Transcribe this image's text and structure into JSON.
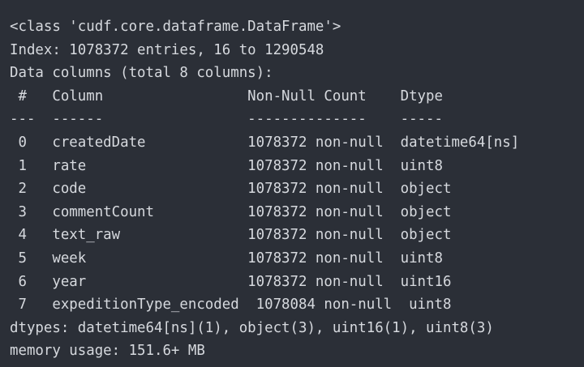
{
  "output": {
    "class_line": "<class 'cudf.core.dataframe.DataFrame'>",
    "index_line": "Index: 1078372 entries, 16 to 1290548",
    "columns_summary": "Data columns (total 8 columns):",
    "header_line": " #   Column                 Non-Null Count    Dtype",
    "separator_line": "---  ------                 --------------    -----",
    "rows": [
      " 0   createdDate            1078372 non-null  datetime64[ns]",
      " 1   rate                   1078372 non-null  uint8",
      " 2   code                   1078372 non-null  object",
      " 3   commentCount           1078372 non-null  object",
      " 4   text_raw               1078372 non-null  object",
      " 5   week                   1078372 non-null  uint8",
      " 6   year                   1078372 non-null  uint16",
      " 7   expeditionType_encoded  1078084 non-null  uint8"
    ],
    "dtypes_line": "dtypes: datetime64[ns](1), object(3), uint16(1), uint8(3)",
    "memory_line": "memory usage: 151.6+ MB"
  },
  "colors": {
    "background": "#2b2f37",
    "text": "#d6d9de"
  }
}
